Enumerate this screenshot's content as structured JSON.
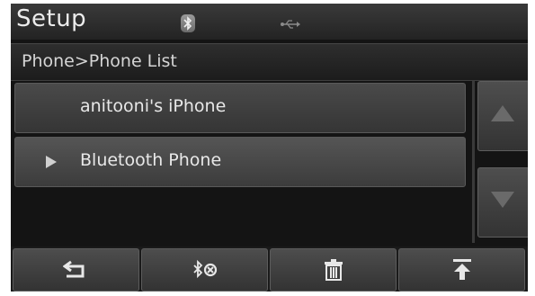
{
  "header": {
    "title": "Setup",
    "status_icons": [
      "bluetooth-icon",
      "usb-icon"
    ]
  },
  "breadcrumb": "Phone>Phone List",
  "phone_list": {
    "items": [
      {
        "label": "anitooni's iPhone",
        "selected": false
      },
      {
        "label": "Bluetooth Phone",
        "selected": true
      }
    ]
  },
  "scroll": {
    "up_icon": "arrow-up-icon",
    "down_icon": "arrow-down-icon"
  },
  "bottom_bar": {
    "buttons": [
      {
        "icon": "back-icon"
      },
      {
        "icon": "bluetooth-disconnect-icon"
      },
      {
        "icon": "trash-icon"
      },
      {
        "icon": "move-to-top-icon"
      }
    ]
  },
  "colors": {
    "background": "#141414",
    "text": "#e8e8e8",
    "button": "#404040"
  }
}
